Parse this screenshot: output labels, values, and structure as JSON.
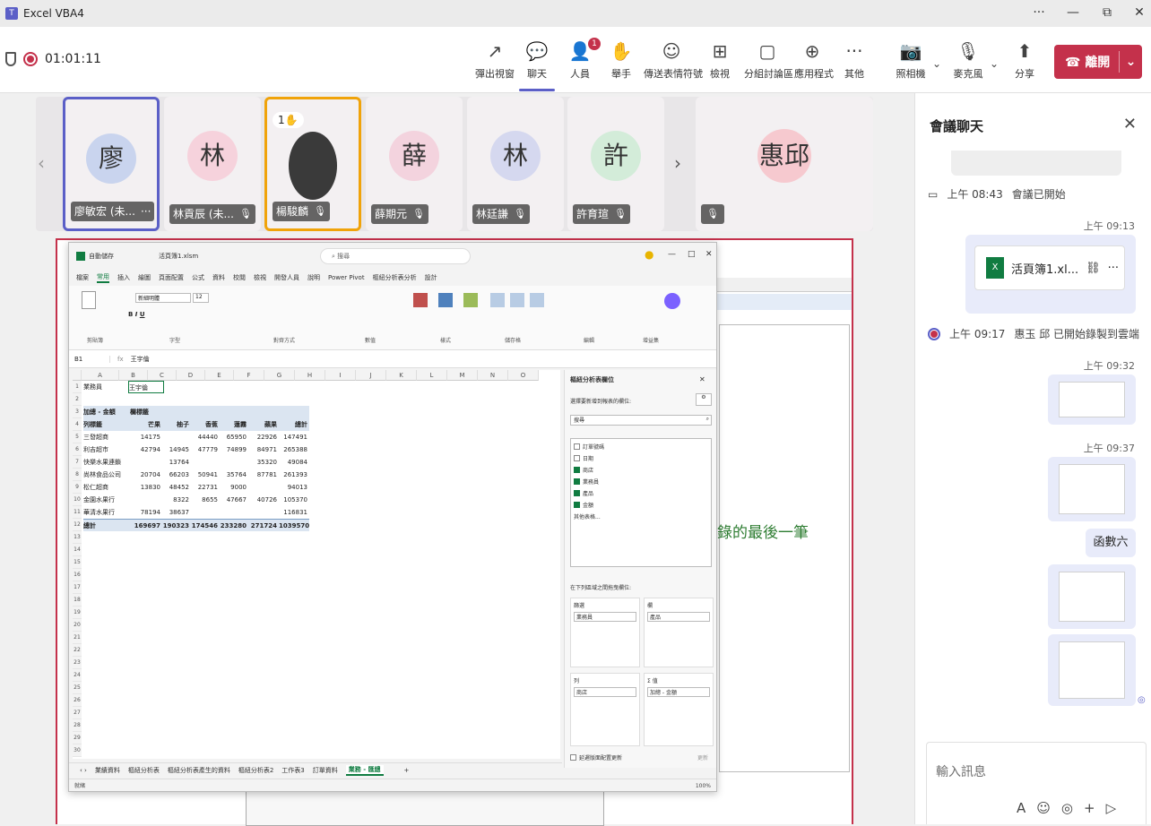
{
  "window": {
    "title": "Excel VBA4",
    "controls": [
      "···",
      "—",
      "⧉",
      "✕"
    ]
  },
  "meeting": {
    "timer": "01:01:11",
    "toolbar": [
      {
        "label": "彈出視窗",
        "icon": "↗"
      },
      {
        "label": "聊天",
        "icon": "💬"
      },
      {
        "label": "人員",
        "icon": "👤",
        "badge": "1"
      },
      {
        "label": "舉手",
        "icon": "✋"
      },
      {
        "label": "傳送表情符號",
        "icon": "☺"
      },
      {
        "label": "檢視",
        "icon": "⊞"
      },
      {
        "label": "分組討論區",
        "icon": "▢"
      },
      {
        "label": "應用程式",
        "icon": "⊕"
      },
      {
        "label": "其他",
        "icon": "···"
      },
      {
        "label": "照相機",
        "icon": "📷"
      },
      {
        "label": "麥克風",
        "icon": "🎙"
      },
      {
        "label": "分享",
        "icon": "⬆"
      }
    ],
    "leave_label": "離開"
  },
  "participants": [
    {
      "initial": "廖",
      "name": "廖敏宏 (未...",
      "color": "#c9d4ee",
      "extra": "···"
    },
    {
      "initial": "林",
      "name": "林貢辰 (未...",
      "color": "#f6d2dc"
    },
    {
      "initial": "",
      "name": "楊駿麟",
      "color": "#333333",
      "hand": "1✋"
    },
    {
      "initial": "薛",
      "name": "薛期元",
      "color": "#f3d3de"
    },
    {
      "initial": "林",
      "name": "林廷謙",
      "color": "#d5d8ef"
    },
    {
      "initial": "許",
      "name": "許育瑄",
      "color": "#d3ecd9"
    },
    {
      "initial": "惠邱",
      "name": "",
      "color": "#f6c9cf"
    }
  ],
  "shared": {
    "bg_text": "錄的最後一筆"
  },
  "excel": {
    "title": "活頁簿1.xlsm",
    "autosave": "自動儲存",
    "search": "搜尋",
    "tabs": [
      "檔案",
      "常用",
      "插入",
      "繪圖",
      "頁面配置",
      "公式",
      "資料",
      "校閱",
      "檢視",
      "開發人員",
      "說明",
      "Power Pivot",
      "樞紐分析表分析",
      "設計"
    ],
    "active_tab": "常用",
    "ribbon_groups": [
      "剪貼簿",
      "字型",
      "對齊方式",
      "數值",
      "樣式",
      "儲存格",
      "編輯",
      "增益集"
    ],
    "font_name": "新細明體",
    "font_size": "12",
    "cell_ref": "B1",
    "formula": "王宇倫",
    "columns": [
      "A",
      "B",
      "C",
      "D",
      "E",
      "F",
      "G",
      "H",
      "I",
      "J",
      "K",
      "L",
      "M",
      "N",
      "O"
    ],
    "filter_label": "業務員",
    "filter_value": "王宇倫",
    "pivot_header": [
      "加總 - 金額",
      "欄標籤"
    ],
    "pivot_cols": [
      "列標籤",
      "芒果",
      "柚子",
      "香蕉",
      "蓮霧",
      "蘋果",
      "總計"
    ],
    "pivot_rows": [
      [
        "三發超商",
        "14175",
        "",
        "44440",
        "65950",
        "22926",
        "147491"
      ],
      [
        "利吉超市",
        "42794",
        "14945",
        "47779",
        "74899",
        "84971",
        "265388"
      ],
      [
        "快樂水果連鎖",
        "",
        "13764",
        "",
        "",
        "35320",
        "49084"
      ],
      [
        "尚林食品公司",
        "20704",
        "66203",
        "50941",
        "35764",
        "87781",
        "261393"
      ],
      [
        "松仁超商",
        "13830",
        "48452",
        "22731",
        "9000",
        "",
        "94013"
      ],
      [
        "金園水果行",
        "",
        "8322",
        "8655",
        "47667",
        "40726",
        "105370"
      ],
      [
        "華清水果行",
        "78194",
        "38637",
        "",
        "",
        "",
        "116831"
      ]
    ],
    "pivot_total": [
      "總計",
      "169697",
      "190323",
      "174546",
      "233280",
      "271724",
      "1039570"
    ],
    "pane": {
      "title": "樞紐分析表欄位",
      "subtitle": "選擇要新增到報表的欄位:",
      "search": "搜尋",
      "fields": [
        {
          "name": "訂單號碼",
          "on": false
        },
        {
          "name": "日期",
          "on": false
        },
        {
          "name": "商店",
          "on": true
        },
        {
          "name": "業務員",
          "on": true
        },
        {
          "name": "產品",
          "on": true
        },
        {
          "name": "金額",
          "on": true
        }
      ],
      "more": "其他表格...",
      "areas_label": "在下列區域之間拖曳欄位:",
      "filter_area": "篩選",
      "filter_item": "業務員",
      "col_area": "欄",
      "col_item": "產品",
      "row_area": "列",
      "row_item": "商店",
      "val_area": "Σ 值",
      "val_item": "加總 - 金額",
      "defer": "延遲版面配置更新",
      "update": "更新"
    },
    "sheets": [
      "業績資料",
      "樞紐分析表",
      "樞紐分析表產生的資料",
      "樞紐分析表2",
      "工作表3",
      "訂單資料",
      "業務 - 匯總"
    ],
    "active_sheet": "業務 - 匯總",
    "status_left": "就緒",
    "status_right": "100%"
  },
  "chat": {
    "title": "會議聊天",
    "sys1_time": "上午 08:43",
    "sys1_text": "會議已開始",
    "t1": "上午 09:13",
    "file_name": "活頁簿1.xl...",
    "sys2_time": "上午 09:17",
    "sys2_text": "惠玉 邱 已開始錄製到雲端",
    "t2": "上午 09:32",
    "t3": "上午 09:37",
    "msg_text": "函數六",
    "compose_placeholder": "輸入訊息"
  }
}
